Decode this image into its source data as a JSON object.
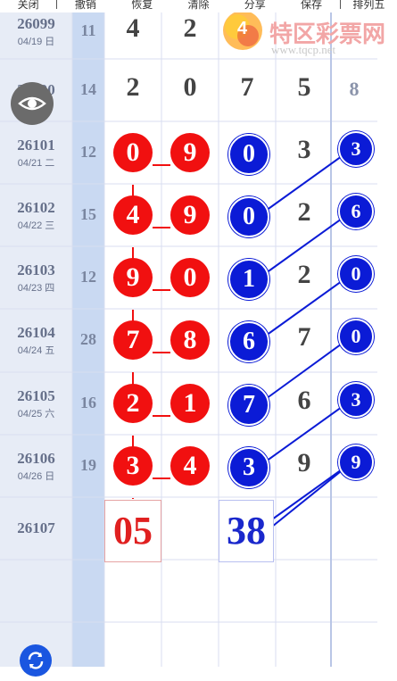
{
  "toolbar": [
    "关闭",
    "撤销",
    "恢复",
    "清除",
    "分享",
    "保存",
    "排列五"
  ],
  "logo": {
    "brand": "特区彩票网",
    "url": "www.tqcp.net"
  },
  "rows": [
    {
      "period": "26099",
      "date": "04/19 日",
      "sum": "11",
      "d": [
        "4",
        "2",
        "",
        ""
      ],
      "extra": ""
    },
    {
      "period": "26100",
      "date": "",
      "sum": "14",
      "d": [
        "2",
        "0",
        "7",
        "5"
      ],
      "extra": "8"
    },
    {
      "period": "26101",
      "date": "04/21 二",
      "sum": "12",
      "d": [
        "0",
        "9",
        "0",
        "3"
      ],
      "extra": "3"
    },
    {
      "period": "26102",
      "date": "04/22 三",
      "sum": "15",
      "d": [
        "4",
        "9",
        "0",
        "2"
      ],
      "extra": "6"
    },
    {
      "period": "26103",
      "date": "04/23 四",
      "sum": "12",
      "d": [
        "9",
        "0",
        "1",
        "2"
      ],
      "extra": "0"
    },
    {
      "period": "26104",
      "date": "04/24 五",
      "sum": "28",
      "d": [
        "7",
        "8",
        "6",
        "7"
      ],
      "extra": "0"
    },
    {
      "period": "26105",
      "date": "04/25 六",
      "sum": "16",
      "d": [
        "2",
        "1",
        "7",
        "6"
      ],
      "extra": "3"
    },
    {
      "period": "26106",
      "date": "04/26 日",
      "sum": "19",
      "d": [
        "3",
        "4",
        "3",
        "9"
      ],
      "extra": "9"
    },
    {
      "period": "26107",
      "date": "",
      "sum": "",
      "d": [
        "",
        "",
        "",
        ""
      ],
      "extra": ""
    }
  ],
  "prediction": {
    "left": "05",
    "right": "38"
  },
  "colors": {
    "red": "#f11010",
    "blue": "#0b1bd6",
    "date_bg": "#e7ecf6",
    "sum_bg": "#c9d9f2"
  }
}
